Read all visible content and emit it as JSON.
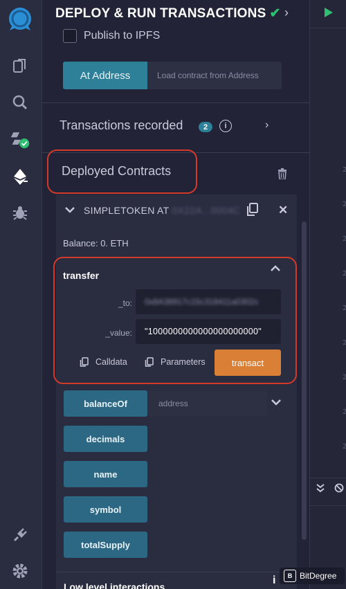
{
  "panel": {
    "title": "DEPLOY & RUN TRANSACTIONS",
    "check_glyph": "✔",
    "chevron_glyph": "›"
  },
  "publish": {
    "label": "Publish to IPFS"
  },
  "at_address": {
    "button_label": "At Address",
    "input_placeholder": "Load contract from Address"
  },
  "transactions": {
    "label": "Transactions recorded",
    "count": "2",
    "info_glyph": "i",
    "chevron_glyph": "›"
  },
  "deployed": {
    "title": "Deployed Contracts",
    "instance": {
      "name": "SIMPLETOKEN AT",
      "address_blurred": "0X22A...0004C",
      "close_glyph": "✕",
      "balance": "Balance: 0. ETH"
    }
  },
  "transfer": {
    "title": "transfer",
    "to_label": "_to:",
    "to_value": "0x8A38917c15c318411a0302c",
    "value_label": "_value:",
    "value_value": "\"1000000000000000000000\"",
    "calldata_label": "Calldata",
    "parameters_label": "Parameters",
    "transact_label": "transact"
  },
  "functions": {
    "balanceOf": "balanceOf",
    "balanceOf_placeholder": "address",
    "decimals": "decimals",
    "name": "name",
    "symbol": "symbol",
    "totalSupply": "totalSupply"
  },
  "low_level": {
    "label": "Low level interactions",
    "info_glyph": "i"
  },
  "watermark": {
    "logo_letter": "B",
    "text": "BitDegree"
  },
  "editor": {
    "gutter_digit": "2"
  },
  "colors": {
    "accent_teal": "#2e7f98",
    "function_button": "#2c6783",
    "transact_orange": "#d97f36",
    "highlight_red": "#d43a2a",
    "success_green": "#2fbf71"
  },
  "icons": [
    "remix-logo-icon",
    "file-explorer-icon",
    "search-icon",
    "solidity-compiler-icon",
    "deploy-run-icon",
    "debugger-icon",
    "plugin-manager-icon",
    "settings-icon"
  ]
}
